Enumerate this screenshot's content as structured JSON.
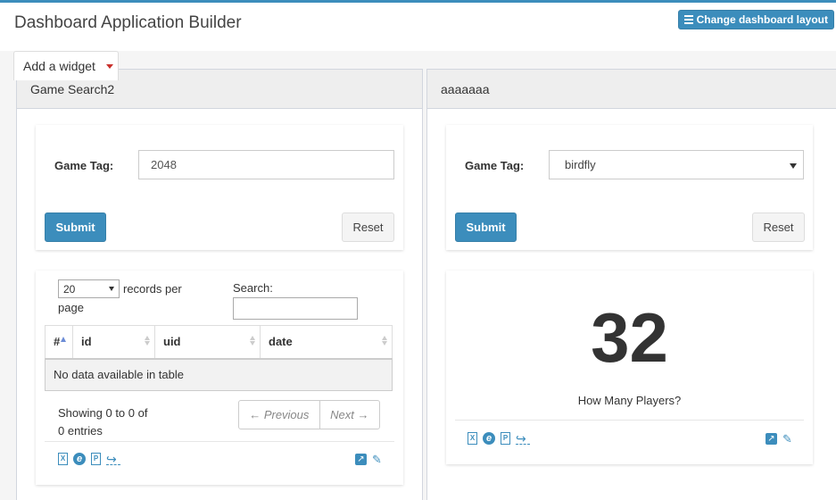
{
  "header": {
    "title": "Dashboard Application Builder",
    "layout_button": "Change dashboard layout"
  },
  "toolbar": {
    "add_widget": "Add a widget"
  },
  "widgets": [
    {
      "title": "Game Search2",
      "form": {
        "label": "Game Tag:",
        "value": "2048",
        "submit": "Submit",
        "reset": "Reset"
      },
      "table": {
        "page_size": "20",
        "records_per_page": "records per",
        "page_word": "page",
        "search_label": "Search:",
        "columns": [
          "#",
          "id",
          "uid",
          "date"
        ],
        "empty_message": "No data available in table",
        "info_line1": "Showing 0 to 0 of",
        "info_line2": "0 entries",
        "previous": "← Previous",
        "next": "Next →"
      }
    },
    {
      "title": "aaaaaaa",
      "form": {
        "label": "Game Tag:",
        "value": "birdfly",
        "submit": "Submit",
        "reset": "Reset"
      },
      "metric": {
        "value": "32",
        "caption": "How Many Players?"
      }
    }
  ],
  "colors": {
    "primary": "#3c8dbc",
    "canvas": "#f5f5f5"
  }
}
